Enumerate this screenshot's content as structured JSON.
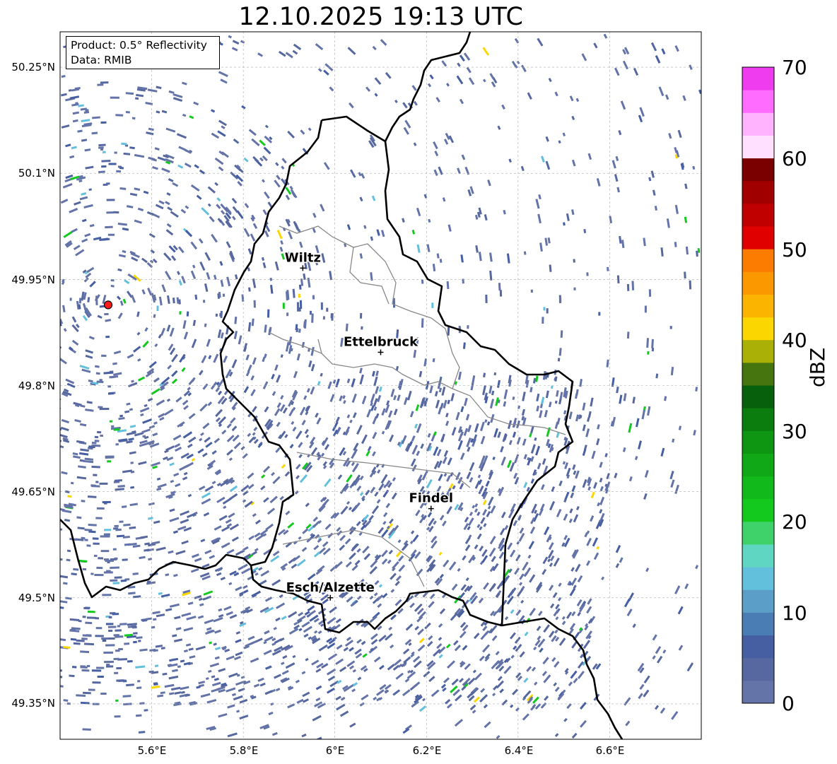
{
  "title": "12.10.2025 19:13 UTC",
  "info": {
    "product": "Product: 0.5° Reflectivity",
    "data_source": "Data: RMIB"
  },
  "axes": {
    "y_ticks": [
      "50.25°N",
      "50.1°N",
      "49.95°N",
      "49.8°N",
      "49.65°N",
      "49.5°N",
      "49.35°N"
    ],
    "x_ticks": [
      "5.6°E",
      "5.8°E",
      "6°E",
      "6.2°E",
      "6.4°E",
      "6.6°E"
    ],
    "lon_range": [
      5.4,
      6.8
    ],
    "lat_range": [
      49.3,
      50.3
    ]
  },
  "cities": [
    {
      "name": "Wiltz",
      "lon": 5.93,
      "lat": 49.966
    },
    {
      "name": "Ettelbruck",
      "lon": 6.1,
      "lat": 49.847
    },
    {
      "name": "Findel",
      "lon": 6.21,
      "lat": 49.626
    },
    {
      "name": "Esch/Alzette",
      "lon": 5.99,
      "lat": 49.5
    }
  ],
  "radar_site": {
    "lon": 5.505,
    "lat": 49.914,
    "color": "#ff1a1a"
  },
  "colorbar": {
    "label": "dBZ",
    "ticks": [
      "0",
      "10",
      "20",
      "30",
      "40",
      "50",
      "60",
      "70"
    ],
    "colors": [
      "#6473a8",
      "#56689f",
      "#465ea2",
      "#4a7db4",
      "#5b9fc8",
      "#63c0dc",
      "#5fd6c2",
      "#3fd26a",
      "#13c91e",
      "#12b91a",
      "#10a816",
      "#0e9512",
      "#0a7d0e",
      "#07600b",
      "#467510",
      "#aab006",
      "#fbd600",
      "#fbb500",
      "#fb9800",
      "#fb7c00",
      "#e00000",
      "#c00000",
      "#a00000",
      "#7a0000",
      "#ffe0ff",
      "#ffb3ff",
      "#ff6cff",
      "#ee3cee"
    ]
  }
}
